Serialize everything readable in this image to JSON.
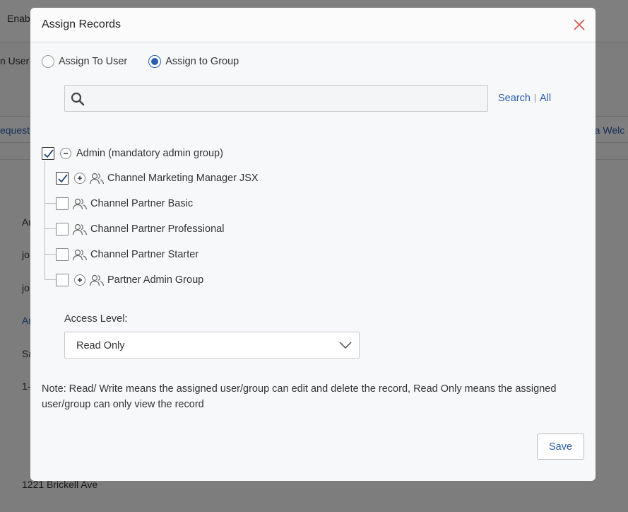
{
  "background": {
    "texts": {
      "t1": "Enab",
      "t2": "n User",
      "t3": "equest",
      "t4": "d a Welc",
      "t5": "Ar",
      "t6": "jo",
      "t7": "jo",
      "t8": "Ar",
      "t9": "Sa",
      "t10": "1-",
      "t11": "1221 Brickell Ave"
    }
  },
  "modal": {
    "title": "Assign Records",
    "close_icon": "close-icon",
    "assign_options": [
      {
        "label": "Assign To User",
        "selected": false
      },
      {
        "label": "Assign to Group",
        "selected": true
      }
    ],
    "search": {
      "placeholder": "",
      "value": "",
      "search_link": "Search",
      "all_link": "All"
    },
    "tree": {
      "root": {
        "label": "Admin (mandatory admin group)",
        "checked": true,
        "expanded": true
      },
      "children": [
        {
          "label": "Channel Marketing Manager JSX",
          "checked": true,
          "expandable": true
        },
        {
          "label": "Channel Partner Basic",
          "checked": false,
          "expandable": false
        },
        {
          "label": "Channel Partner Professional",
          "checked": false,
          "expandable": false
        },
        {
          "label": "Channel Partner Starter",
          "checked": false,
          "expandable": false
        },
        {
          "label": "Partner Admin Group",
          "checked": false,
          "expandable": true
        }
      ]
    },
    "access_level": {
      "label": "Access Level:",
      "selected": "Read Only"
    },
    "note": "Note: Read/ Write means the assigned user/group can edit and delete the record, Read Only means the assigned user/group can only view the record",
    "save_label": "Save"
  },
  "colors": {
    "accent": "#2a5db0",
    "close": "#d9534f",
    "overlay": "rgba(0,0,0,0.5)"
  }
}
